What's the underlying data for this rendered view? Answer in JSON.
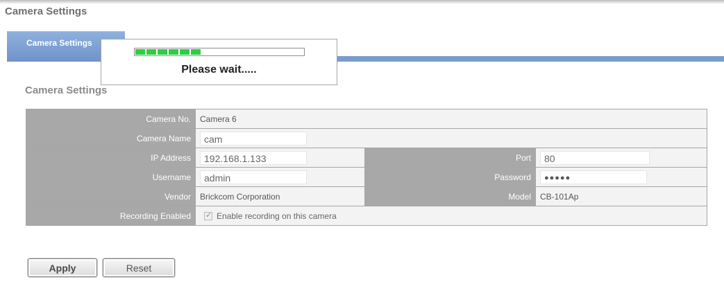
{
  "page": {
    "title": "Camera Settings"
  },
  "tab": {
    "label": "Camera Settings"
  },
  "section": {
    "title": "Camera Settings"
  },
  "form": {
    "camera_no": {
      "label": "Camera No.",
      "value": "Camera 6"
    },
    "camera_name": {
      "label": "Camera Name",
      "value": "cam"
    },
    "ip_address": {
      "label": "IP Address",
      "value": "192.168.1.133"
    },
    "port": {
      "label": "Port",
      "value": "80"
    },
    "username": {
      "label": "Username",
      "value": "admin"
    },
    "password": {
      "label": "Password",
      "value": "●●●●●"
    },
    "vendor": {
      "label": "Vendor",
      "value": "Brickcom Corporation"
    },
    "model": {
      "label": "Model",
      "value": "CB-101Ap"
    },
    "recording_enabled": {
      "label": "Recording Enabled",
      "checkbox_label": "Enable recording on this camera",
      "checked": true
    }
  },
  "buttons": {
    "apply": "Apply",
    "reset": "Reset"
  },
  "loading": {
    "message": "Please wait.....",
    "progress": 0.39
  },
  "colors": {
    "tab": "#7a9ccc",
    "label_cell": "#a8a8a8",
    "value_cell": "#f3f3f3",
    "progress": "#2fcd44"
  }
}
